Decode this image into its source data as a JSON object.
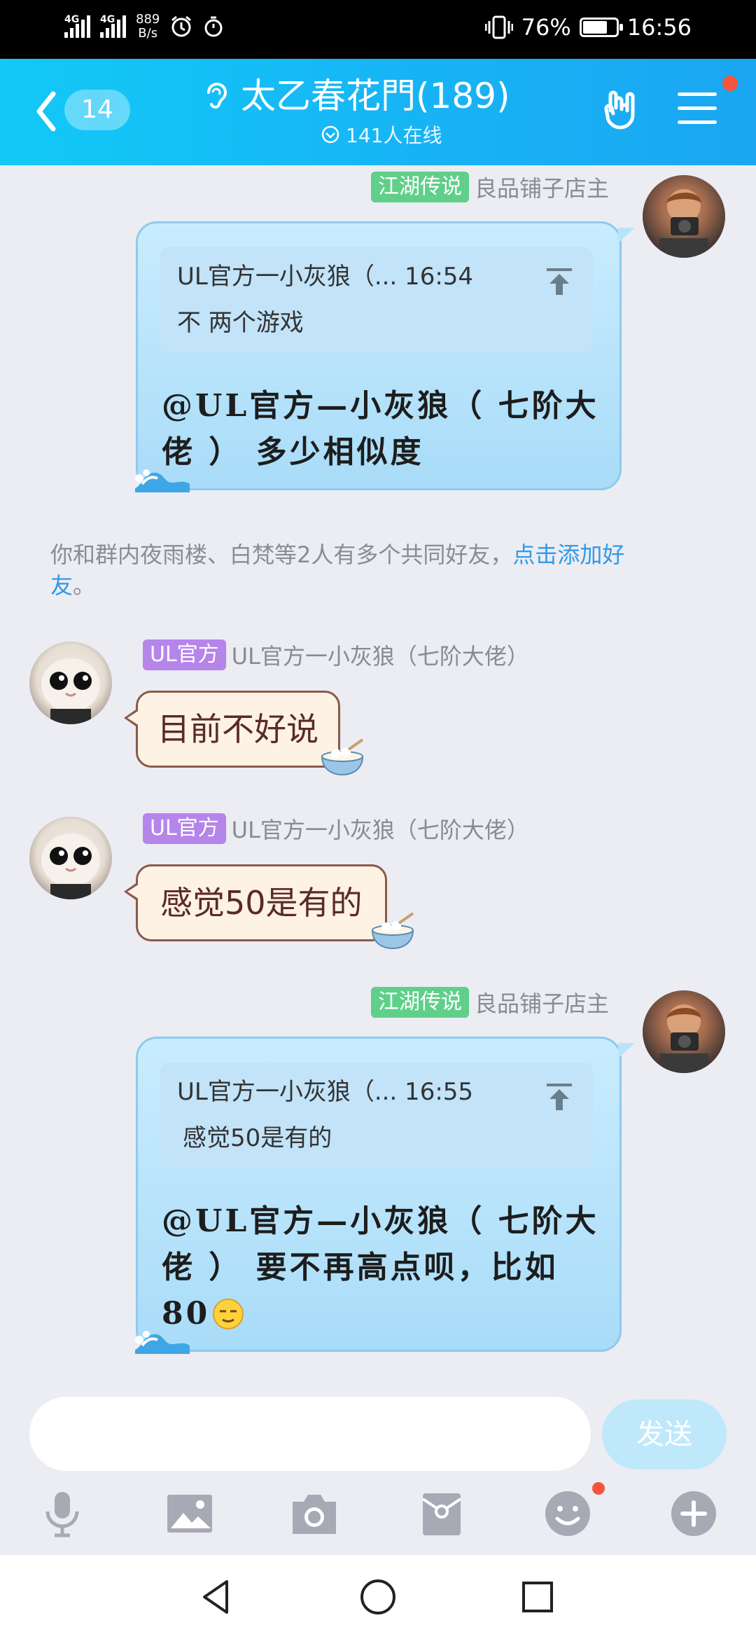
{
  "status_bar": {
    "signal1_tag": "4G",
    "signal2_tag": "4G",
    "speed_value": "889",
    "speed_unit": "B/s",
    "battery": "76%",
    "battery_level": 0.76,
    "time": "16:56"
  },
  "header": {
    "unread_count": "14",
    "group_name": "太乙春花門(189)",
    "online_text": "141人在线"
  },
  "messages": [
    {
      "badge": "江湖传说",
      "sender": "良品铺子店主",
      "quote_header": "UL官方一小灰狼（... 16:54",
      "quote_text": "不 两个游戏",
      "body_line1": "@UL官方—小灰狼（ 七阶大",
      "body_line2": "佬 ） 多少相似度"
    },
    {
      "badge": "UL官方",
      "sender": "UL官方一小灰狼（七阶大佬）",
      "text": "目前不好说"
    },
    {
      "badge": "UL官方",
      "sender": "UL官方一小灰狼（七阶大佬）",
      "text": "感觉50是有的"
    },
    {
      "badge": "江湖传说",
      "sender": "良品铺子店主",
      "quote_header": "UL官方一小灰狼（... 16:55",
      "quote_text": "感觉50是有的",
      "body_line1": "@UL官方—小灰狼（ 七阶大",
      "body_line2": "佬 ） 要不再高点呗，比如",
      "body_line3": "80"
    }
  ],
  "system_message": {
    "text": "你和群内夜雨楼、白梵等2人有多个共同好友，",
    "link_part1": "点击添加好",
    "link_part2": "友",
    "suffix": "。"
  },
  "input": {
    "placeholder": "",
    "send_label": "发送"
  },
  "toolbar": [
    "microphone-icon",
    "image-icon",
    "camera-icon",
    "red-packet-icon",
    "emoji-icon",
    "plus-icon"
  ],
  "colors": {
    "header_start": "#12c9f6",
    "header_end": "#1aa6f2",
    "badge_green": "#5fcf8a",
    "badge_purple": "#b585ea",
    "link": "#2f9be8",
    "notification_dot": "#f5553a"
  }
}
